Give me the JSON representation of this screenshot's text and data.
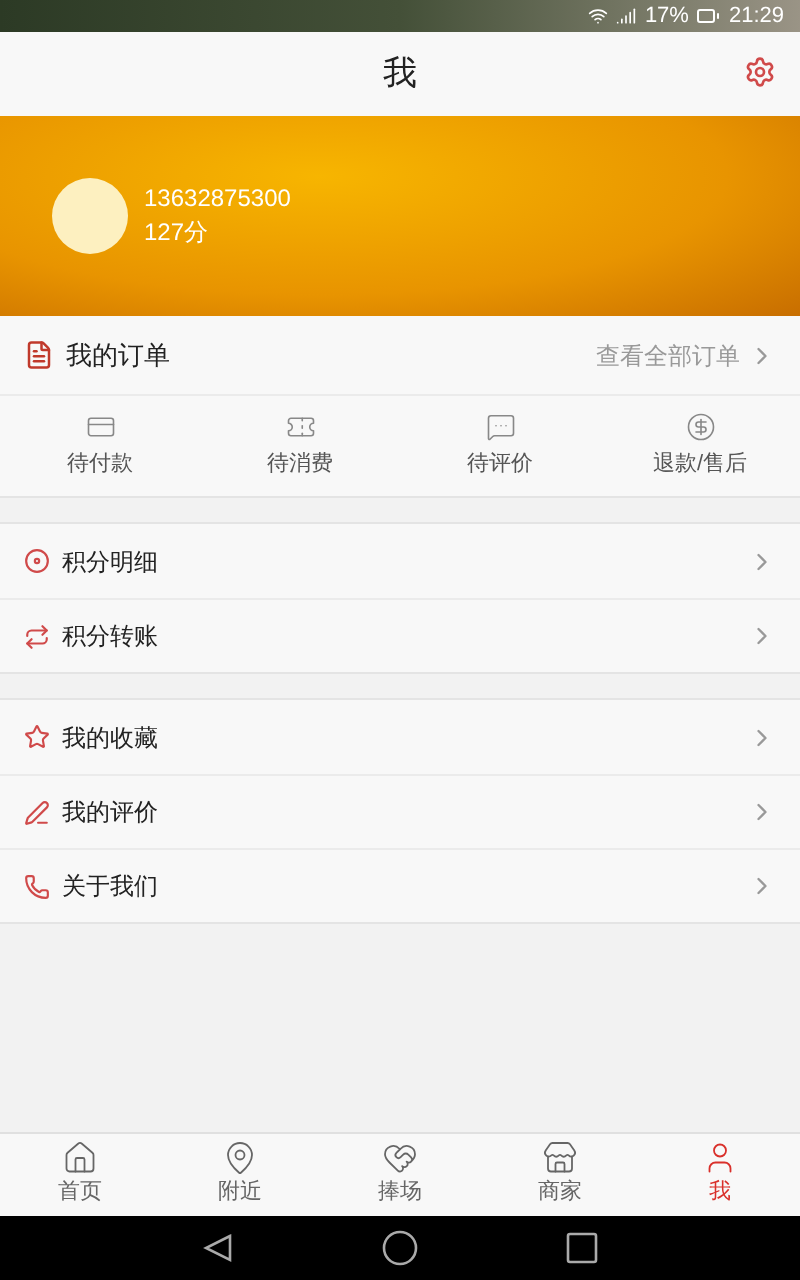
{
  "status_bar": {
    "battery": "17%",
    "time": "21:29"
  },
  "header": {
    "title": "我"
  },
  "profile": {
    "phone": "13632875300",
    "points": "127分"
  },
  "orders": {
    "title": "我的订单",
    "link": "查看全部订单",
    "items": [
      {
        "label": "待付款"
      },
      {
        "label": "待消费"
      },
      {
        "label": "待评价"
      },
      {
        "label": "退款/售后"
      }
    ]
  },
  "menu_groups": [
    [
      {
        "label": "积分明细"
      },
      {
        "label": "积分转账"
      }
    ],
    [
      {
        "label": "我的收藏"
      },
      {
        "label": "我的评价"
      },
      {
        "label": "关于我们"
      }
    ]
  ],
  "tab_bar": [
    {
      "label": "首页",
      "selected": false
    },
    {
      "label": "附近",
      "selected": false
    },
    {
      "label": "捧场",
      "selected": false
    },
    {
      "label": "商家",
      "selected": false
    },
    {
      "label": "我",
      "selected": true
    }
  ]
}
